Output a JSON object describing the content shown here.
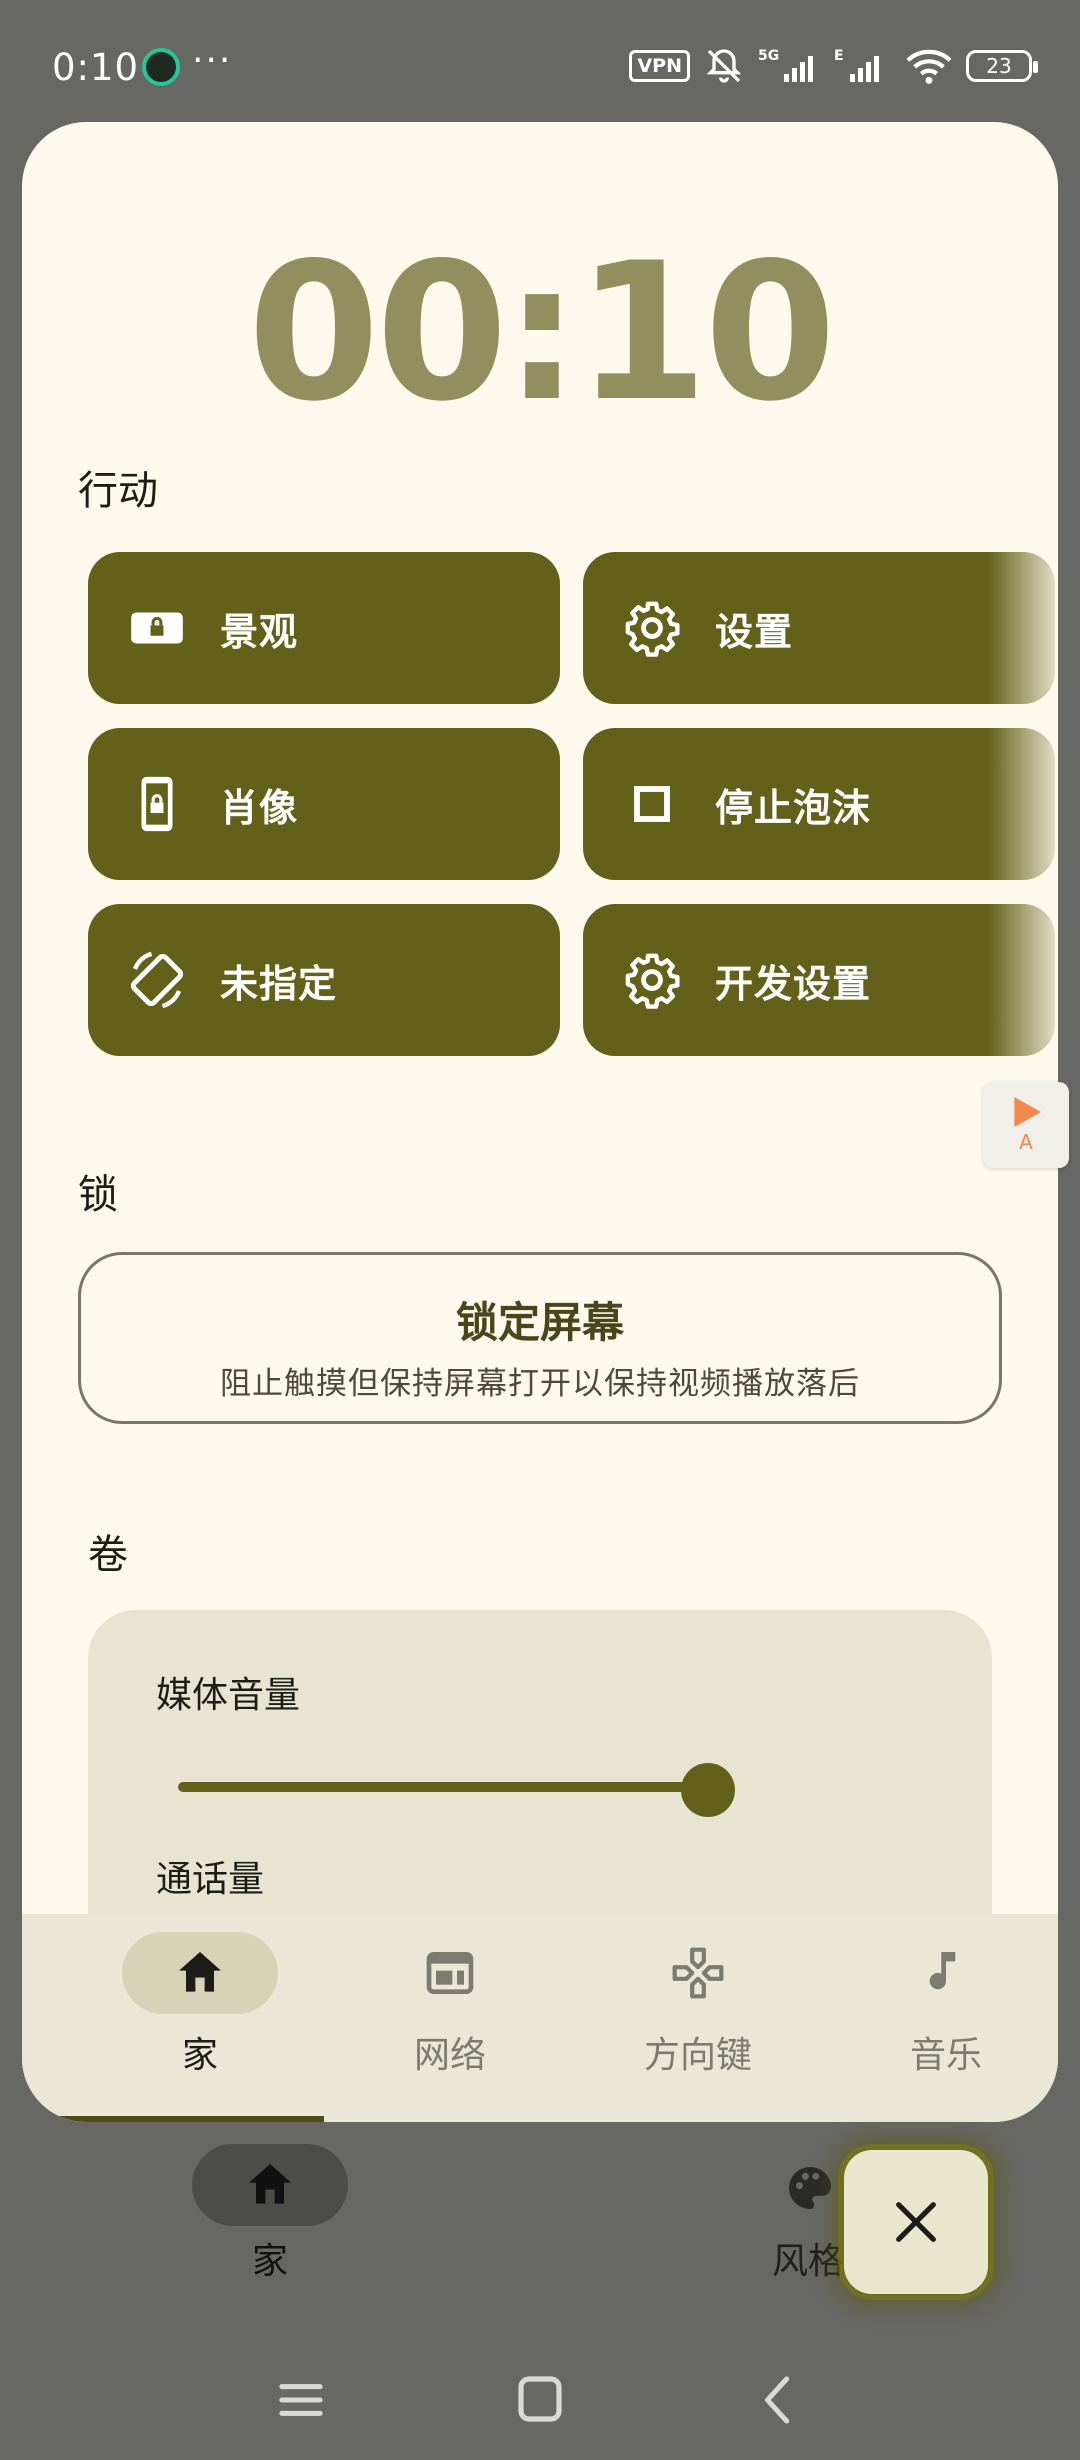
{
  "status_bar": {
    "time": "0:10",
    "more": "···",
    "vpn": "VPN",
    "network_5g": "5G",
    "network_e": "E",
    "battery": "23"
  },
  "timer": {
    "display": "00:10"
  },
  "sections": {
    "actions": "行动",
    "lock": "锁",
    "volume": "卷"
  },
  "actions": [
    {
      "label": "景观",
      "icon": "landscape-lock-icon"
    },
    {
      "label": "设置",
      "icon": "gear-icon"
    },
    {
      "label": "肖像",
      "icon": "portrait-lock-icon"
    },
    {
      "label": "停止泡沫",
      "icon": "stop-square-icon"
    },
    {
      "label": "未指定",
      "icon": "rotate-icon"
    },
    {
      "label": "开发设置",
      "icon": "gear-icon"
    }
  ],
  "lock_screen": {
    "title": "锁定屏幕",
    "subtitle": "阻止触摸但保持屏幕打开以保持视频播放落后"
  },
  "volume": {
    "media_label": "媒体音量",
    "media_level": 1.0,
    "call_label": "通话量"
  },
  "tabs": [
    {
      "label": "家",
      "icon": "home-icon",
      "active": true
    },
    {
      "label": "网络",
      "icon": "web-icon",
      "active": false
    },
    {
      "label": "方向键",
      "icon": "dpad-icon",
      "active": false
    },
    {
      "label": "音乐",
      "icon": "music-note-icon",
      "active": false
    }
  ],
  "background_nav": {
    "home_label": "家",
    "style_label": "风格"
  },
  "float_widget": {
    "letter": "A"
  },
  "colors": {
    "primary": "#636119",
    "surface": "#fdf9ec",
    "timer": "#918f5e",
    "scrim": "#676764"
  }
}
